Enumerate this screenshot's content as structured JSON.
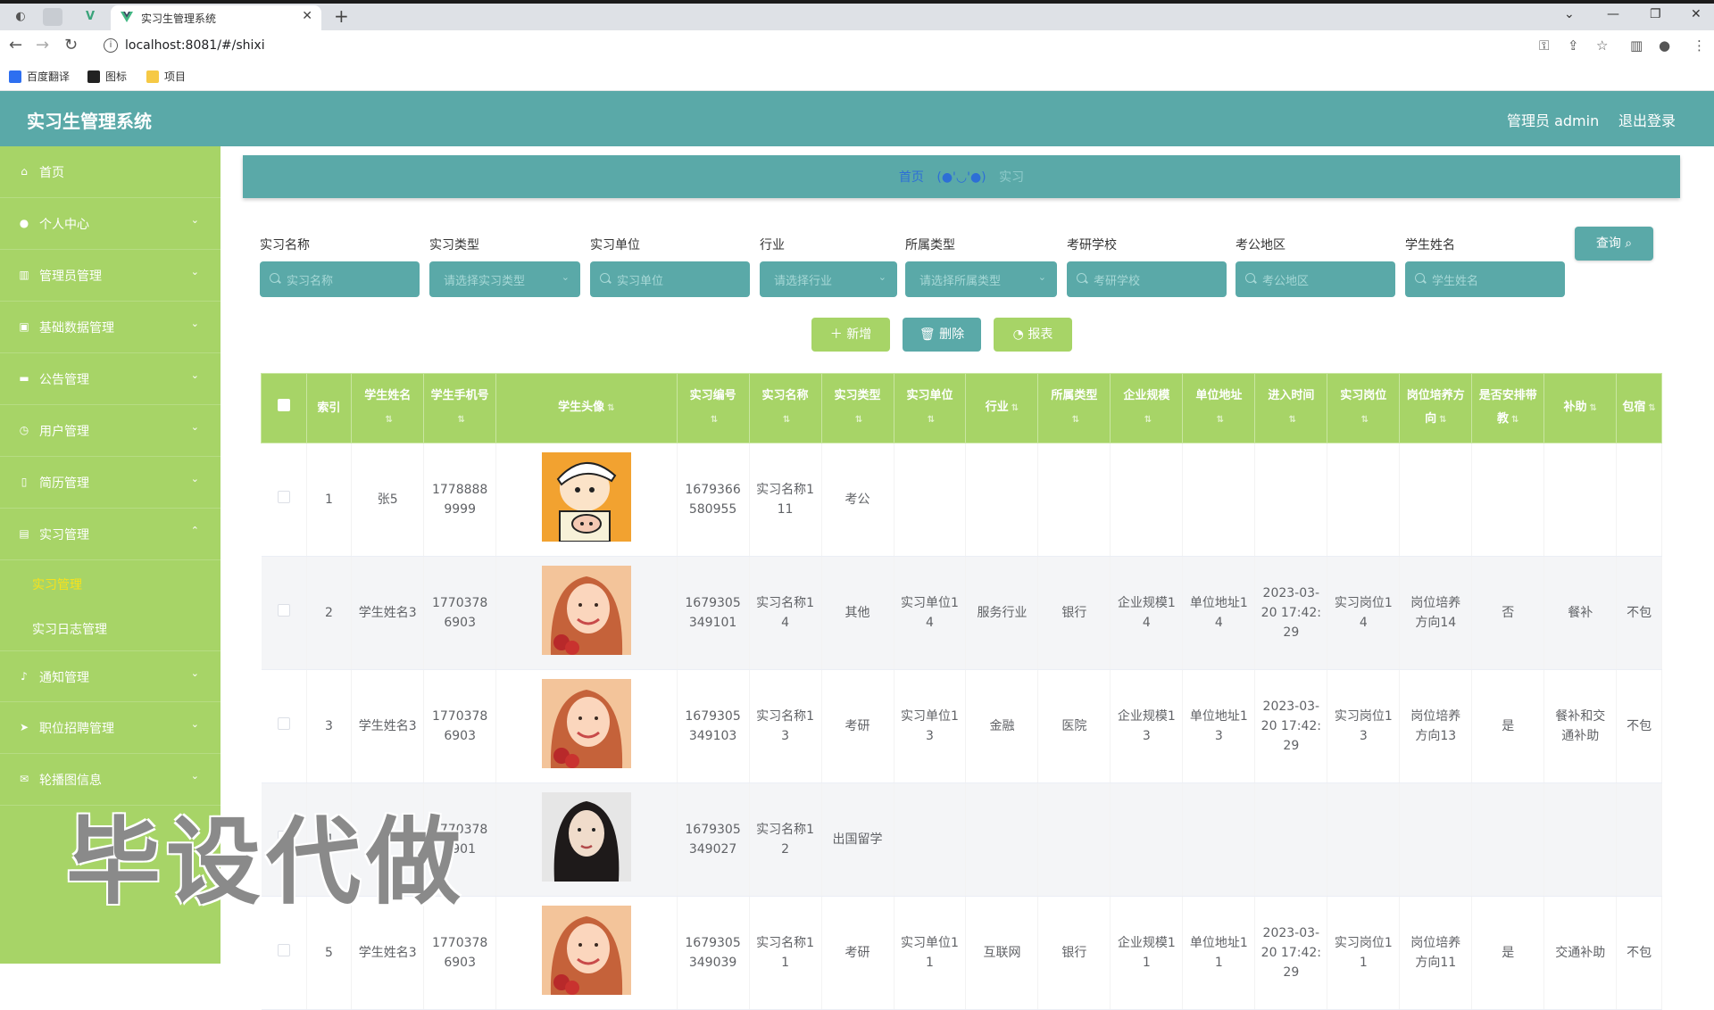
{
  "browser": {
    "tab_title": "实习生管理系统",
    "url": "localhost:8081/#/shixi",
    "bookmarks": [
      "百度翻译",
      "图标",
      "项目"
    ]
  },
  "header": {
    "title": "实习生管理系统",
    "user": "管理员 admin",
    "logout": "退出登录"
  },
  "sidebar": {
    "items": [
      {
        "label": "首页",
        "icon": "home-icon"
      },
      {
        "label": "个人中心",
        "icon": "user-icon"
      },
      {
        "label": "管理员管理",
        "icon": "chart-icon"
      },
      {
        "label": "基础数据管理",
        "icon": "image-icon"
      },
      {
        "label": "公告管理",
        "icon": "message-icon"
      },
      {
        "label": "用户管理",
        "icon": "clock-icon"
      },
      {
        "label": "简历管理",
        "icon": "mobile-icon"
      },
      {
        "label": "实习管理",
        "icon": "document-icon"
      }
    ],
    "submenu": [
      {
        "label": "实习管理"
      },
      {
        "label": "实习日志管理"
      }
    ],
    "items_after": [
      {
        "label": "通知管理",
        "icon": "bell-icon"
      },
      {
        "label": "职位招聘管理",
        "icon": "send-icon"
      },
      {
        "label": "轮播图信息",
        "icon": "mail-icon"
      }
    ]
  },
  "watermark": "毕设代做",
  "breadcrumb": {
    "home": "首页",
    "separator": "(●'◡'●)",
    "current": "实习"
  },
  "filters": [
    {
      "label": "实习名称",
      "placeholder": "实习名称",
      "type": "input"
    },
    {
      "label": "实习类型",
      "placeholder": "请选择实习类型",
      "type": "select"
    },
    {
      "label": "实习单位",
      "placeholder": "实习单位",
      "type": "input"
    },
    {
      "label": "行业",
      "placeholder": "请选择行业",
      "type": "select"
    },
    {
      "label": "所属类型",
      "placeholder": "请选择所属类型",
      "type": "select"
    },
    {
      "label": "考研学校",
      "placeholder": "考研学校",
      "type": "input"
    },
    {
      "label": "考公地区",
      "placeholder": "考公地区",
      "type": "input"
    },
    {
      "label": "学生姓名",
      "placeholder": "学生姓名",
      "type": "input"
    }
  ],
  "buttons": {
    "query": "查询",
    "add": "新增",
    "delete": "删除",
    "report": "报表"
  },
  "table": {
    "columns": [
      "索引",
      "学生姓名",
      "学生手机号",
      "学生头像",
      "实习编号",
      "实习名称",
      "实习类型",
      "实习单位",
      "行业",
      "所属类型",
      "企业规模",
      "单位地址",
      "进入时间",
      "实习岗位",
      "岗位培养方向",
      "是否安排带教",
      "补助",
      "包宿"
    ],
    "rows": [
      {
        "index": "1",
        "name": "张5",
        "phone": "17788889999",
        "avatar": "cartoon",
        "code": "1679366580955",
        "title": "实习名称111",
        "type": "考公",
        "unit": "",
        "industry": "",
        "category": "",
        "scale": "",
        "address": "",
        "time": "",
        "post": "",
        "direction": "",
        "mentor": "",
        "subsidy": "",
        "lodging": ""
      },
      {
        "index": "2",
        "name": "学生姓名3",
        "phone": "17703786903",
        "avatar": "girl",
        "code": "1679305349101",
        "title": "实习名称14",
        "type": "其他",
        "unit": "实习单位14",
        "industry": "服务行业",
        "category": "银行",
        "scale": "企业规模14",
        "address": "单位地址14",
        "time": "2023-03-20 17:42:29",
        "post": "实习岗位14",
        "direction": "岗位培养方向14",
        "mentor": "否",
        "subsidy": "餐补",
        "lodging": "不包"
      },
      {
        "index": "3",
        "name": "学生姓名3",
        "phone": "17703786903",
        "avatar": "girl",
        "code": "1679305349103",
        "title": "实习名称13",
        "type": "考研",
        "unit": "实习单位13",
        "industry": "金融",
        "category": "医院",
        "scale": "企业规模13",
        "address": "单位地址13",
        "time": "2023-03-20 17:42:29",
        "post": "实习岗位13",
        "direction": "岗位培养方向13",
        "mentor": "是",
        "subsidy": "餐补和交通补助",
        "lodging": "不包"
      },
      {
        "index": "4",
        "name": "",
        "phone": "17703786901",
        "avatar": "woman",
        "code": "1679305349027",
        "title": "实习名称12",
        "type": "出国留学",
        "unit": "",
        "industry": "",
        "category": "",
        "scale": "",
        "address": "",
        "time": "",
        "post": "",
        "direction": "",
        "mentor": "",
        "subsidy": "",
        "lodging": ""
      },
      {
        "index": "5",
        "name": "学生姓名3",
        "phone": "17703786903",
        "avatar": "girl",
        "code": "1679305349039",
        "title": "实习名称11",
        "type": "考研",
        "unit": "实习单位11",
        "industry": "互联网",
        "category": "银行",
        "scale": "企业规模11",
        "address": "单位地址11",
        "time": "2023-03-20 17:42:29",
        "post": "实习岗位11",
        "direction": "岗位培养方向11",
        "mentor": "是",
        "subsidy": "交通补助",
        "lodging": "不包"
      }
    ]
  },
  "colors": {
    "teal": "#5aa9a8",
    "green": "#a7d467",
    "active_submenu": "#f7e21b",
    "breadcrumb_link": "#2d6fd6"
  }
}
